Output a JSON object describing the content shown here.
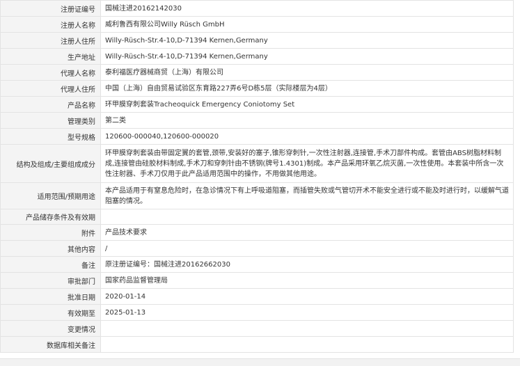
{
  "record": {
    "rows": [
      {
        "label": "注册证编号",
        "value": "国械注进20162142030"
      },
      {
        "label": "注册人名称",
        "value": "威利鲁西有限公司Willy Rüsch GmbH"
      },
      {
        "label": "注册人住所",
        "value": "Willy-Rüsch-Str.4-10,D-71394 Kernen,Germany"
      },
      {
        "label": "生产地址",
        "value": "Willy-Rüsch-Str.4-10,D-71394 Kernen,Germany"
      },
      {
        "label": "代理人名称",
        "value": "泰利福医疗器械商贸（上海）有限公司"
      },
      {
        "label": "代理人住所",
        "value": "中国（上海）自由贸易试验区东育路227弄6号D栋5层（实际楼层为4层）"
      },
      {
        "label": "产品名称",
        "value": "环甲膜穿刺套装Tracheoquick Emergency Coniotomy Set"
      },
      {
        "label": "管理类别",
        "value": "第二类"
      },
      {
        "label": "型号规格",
        "value": "120600-000040,120600-000020"
      },
      {
        "label": "结构及组成/主要组成成分",
        "value": "环甲膜穿刺套装由带固定翼的套管,颈带,安装好的塞子,锥形穿刺针,一次性注射器,连接管,手术刀部件构成。套管由ABS树脂材料制成,连接管由硅胶材料制成,手术刀和穿刺针由不锈钢(牌号1.4301)制成。本产品采用环氧乙烷灭菌,一次性使用。本套装中所含一次性注射器、手术刀仅用于此产品适用范围中的操作，不用做其他用途。"
      },
      {
        "label": "适用范围/预期用途",
        "value": "本产品适用于有窒息危险时，在急诊情况下有上呼吸道阻塞，而插管失败或气管切开术不能安全进行或不能及时进行时，以缓解气道阻塞的情况。"
      },
      {
        "label": "产品储存条件及有效期",
        "value": ""
      },
      {
        "label": "附件",
        "value": "产品技术要求"
      },
      {
        "label": "其他内容",
        "value": "/"
      },
      {
        "label": "备注",
        "value": "原注册证编号：国械注进20162662030"
      },
      {
        "label": "审批部门",
        "value": "国家药品监督管理局"
      },
      {
        "label": "批准日期",
        "value": "2020-01-14"
      },
      {
        "label": "有效期至",
        "value": "2025-01-13"
      },
      {
        "label": "变更情况",
        "value": ""
      },
      {
        "label": "数据库相关备注",
        "value": ""
      }
    ]
  }
}
